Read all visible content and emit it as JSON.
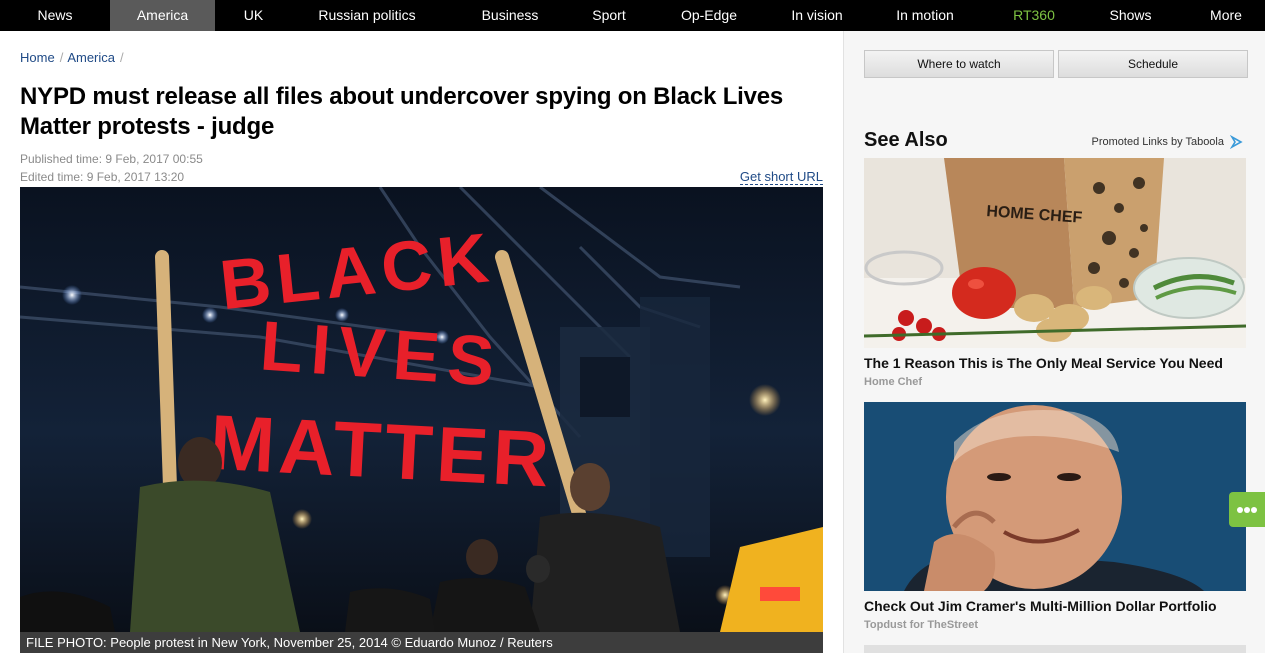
{
  "nav": {
    "items": [
      {
        "label": "News"
      },
      {
        "label": "America"
      },
      {
        "label": "UK"
      },
      {
        "label": "Russian politics"
      },
      {
        "label": "Business"
      },
      {
        "label": "Sport"
      },
      {
        "label": "Op-Edge"
      },
      {
        "label": "In vision"
      },
      {
        "label": "In motion"
      },
      {
        "label": "RT360"
      },
      {
        "label": "Shows"
      },
      {
        "label": "More"
      }
    ],
    "active": "America",
    "accent_item": "RT360",
    "accent_color": "#7dc242"
  },
  "breadcrumb": {
    "home": "Home",
    "section": "America"
  },
  "article": {
    "title": "NYPD must release all files about undercover spying on Black Lives Matter protests - judge",
    "published": "Published time: 9 Feb, 2017 00:55",
    "edited": "Edited time: 9 Feb, 2017 13:20",
    "short_url": "Get short URL",
    "banner_lines": [
      "BLACK",
      "LIVES",
      "MATTER"
    ],
    "caption": "FILE PHOTO: People protest in New York, November 25, 2014 © Eduardo Munoz / Reuters"
  },
  "sidebar": {
    "where_to_watch": "Where to watch",
    "schedule": "Schedule",
    "see_also": "See Also",
    "promoted": "Promoted Links by Taboola",
    "cards": [
      {
        "title": "The 1 Reason This is The Only Meal Service You Need",
        "source": "Home Chef",
        "image_text": "HOME CHEF"
      },
      {
        "title": "Check Out Jim Cramer's Multi-Million Dollar Portfolio",
        "source": "Topdust for TheStreet"
      }
    ]
  },
  "colors": {
    "nav_bg": "#000000",
    "nav_active": "#5a5a5a",
    "link": "#1f4a86",
    "banner_red": "#e8202a",
    "float_button": "#7dc242"
  }
}
